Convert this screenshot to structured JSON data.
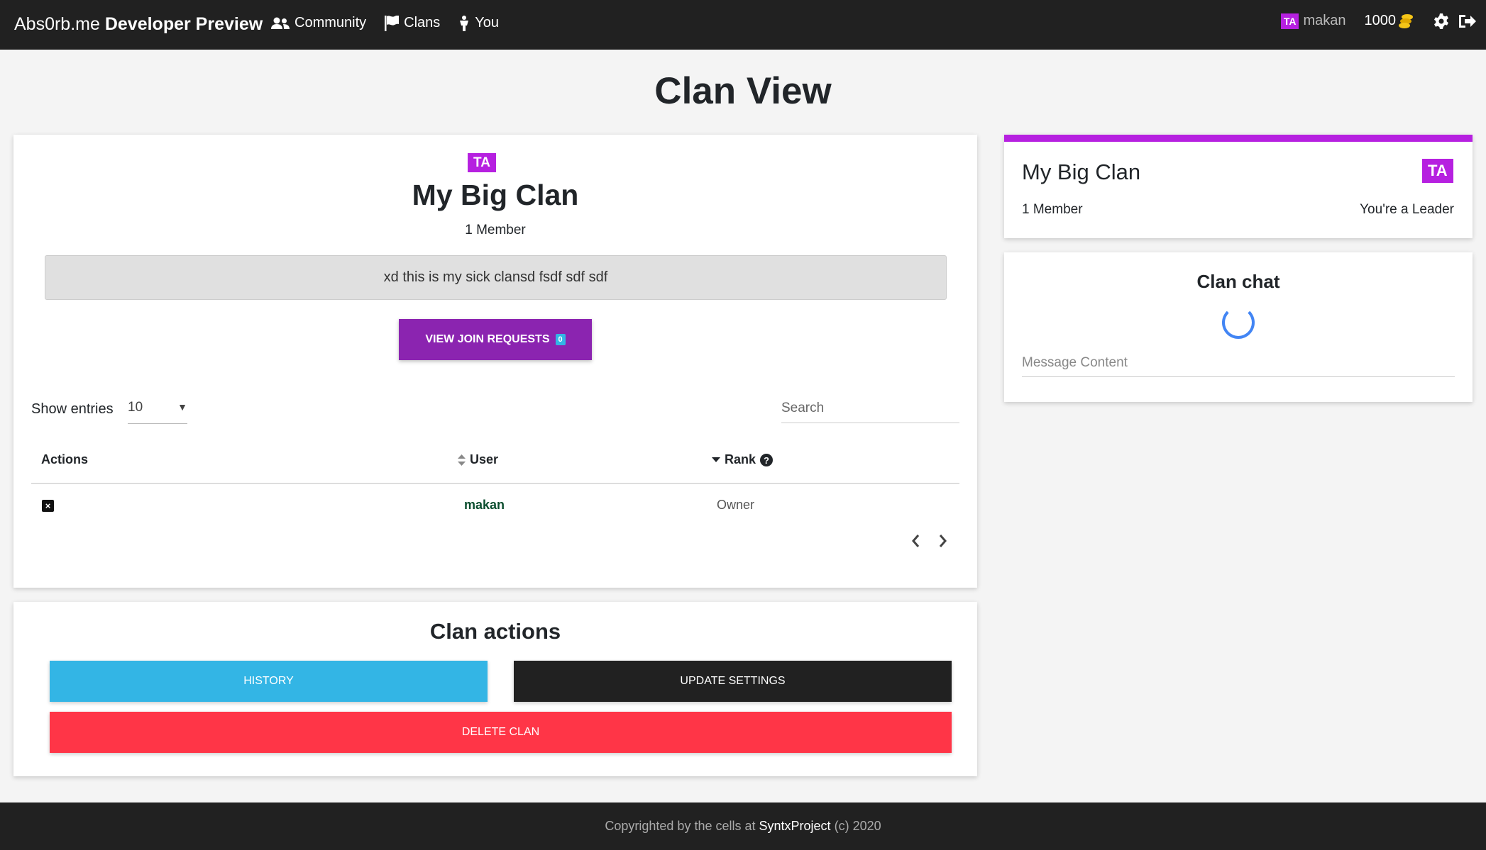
{
  "navbar": {
    "brand_regular": "Abs0rb.me",
    "brand_bold": "Developer Preview",
    "links": [
      {
        "label": "Community",
        "icon": "users-icon"
      },
      {
        "label": "Clans",
        "icon": "flag-icon"
      },
      {
        "label": "You",
        "icon": "user-icon"
      }
    ],
    "user_tag": "TA",
    "username": "makan",
    "coins": "1000"
  },
  "page": {
    "title": "Clan View"
  },
  "clan": {
    "tag": "TA",
    "name": "My Big Clan",
    "members": "1 Member",
    "description": "xd this is my sick clansd fsdf sdf sdf",
    "join_requests_label": "VIEW JOIN REQUESTS",
    "join_requests_count": "0"
  },
  "table": {
    "show_entries_label": "Show entries",
    "entries_value": "10",
    "search_placeholder": "Search",
    "headers": {
      "actions": "Actions",
      "user": "User",
      "rank": "Rank"
    },
    "rows": [
      {
        "user": "makan",
        "rank": "Owner"
      }
    ]
  },
  "actions": {
    "title": "Clan actions",
    "history": "HISTORY",
    "update_settings": "UPDATE SETTINGS",
    "delete_clan": "DELETE CLAN"
  },
  "sidebar": {
    "clan_name": "My Big Clan",
    "tag": "TA",
    "members": "1 Member",
    "role": "You're a Leader",
    "accent_color": "#b620e0"
  },
  "chat": {
    "title": "Clan chat",
    "message_placeholder": "Message Content"
  },
  "footer": {
    "prefix": "Copyrighted by the cells at",
    "link": "SyntxProject",
    "suffix": "(c) 2020"
  },
  "colors": {
    "navbar": "#212121",
    "primary_purple": "#8b24b0",
    "tag_purple": "#b620e0",
    "info": "#33b5e5",
    "danger": "#ff3547"
  }
}
